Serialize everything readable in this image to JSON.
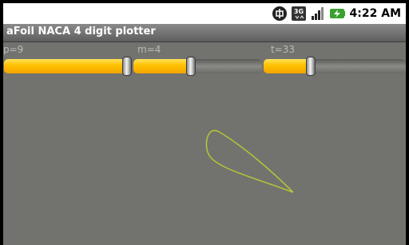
{
  "status_bar": {
    "time": "4:22 AM",
    "network_label": "3G",
    "icons": [
      "chinese-input-icon",
      "3g-data-icon",
      "signal-strength-icon",
      "battery-charging-icon"
    ]
  },
  "app": {
    "title": "aFoil NACA 4 digit plotter"
  },
  "sliders": [
    {
      "label": "p=9",
      "value": 9,
      "fraction": 1.0
    },
    {
      "label": "m=4",
      "value": 4,
      "fraction": 0.45
    },
    {
      "label": "t=33",
      "value": 33,
      "fraction": 0.33
    }
  ],
  "plot": {
    "curve_color": "#b5c23a",
    "background": "#72736e"
  },
  "colors": {
    "accent": "#ffbf00",
    "title_text": "#ffffff",
    "label_text": "#b9bab6"
  }
}
